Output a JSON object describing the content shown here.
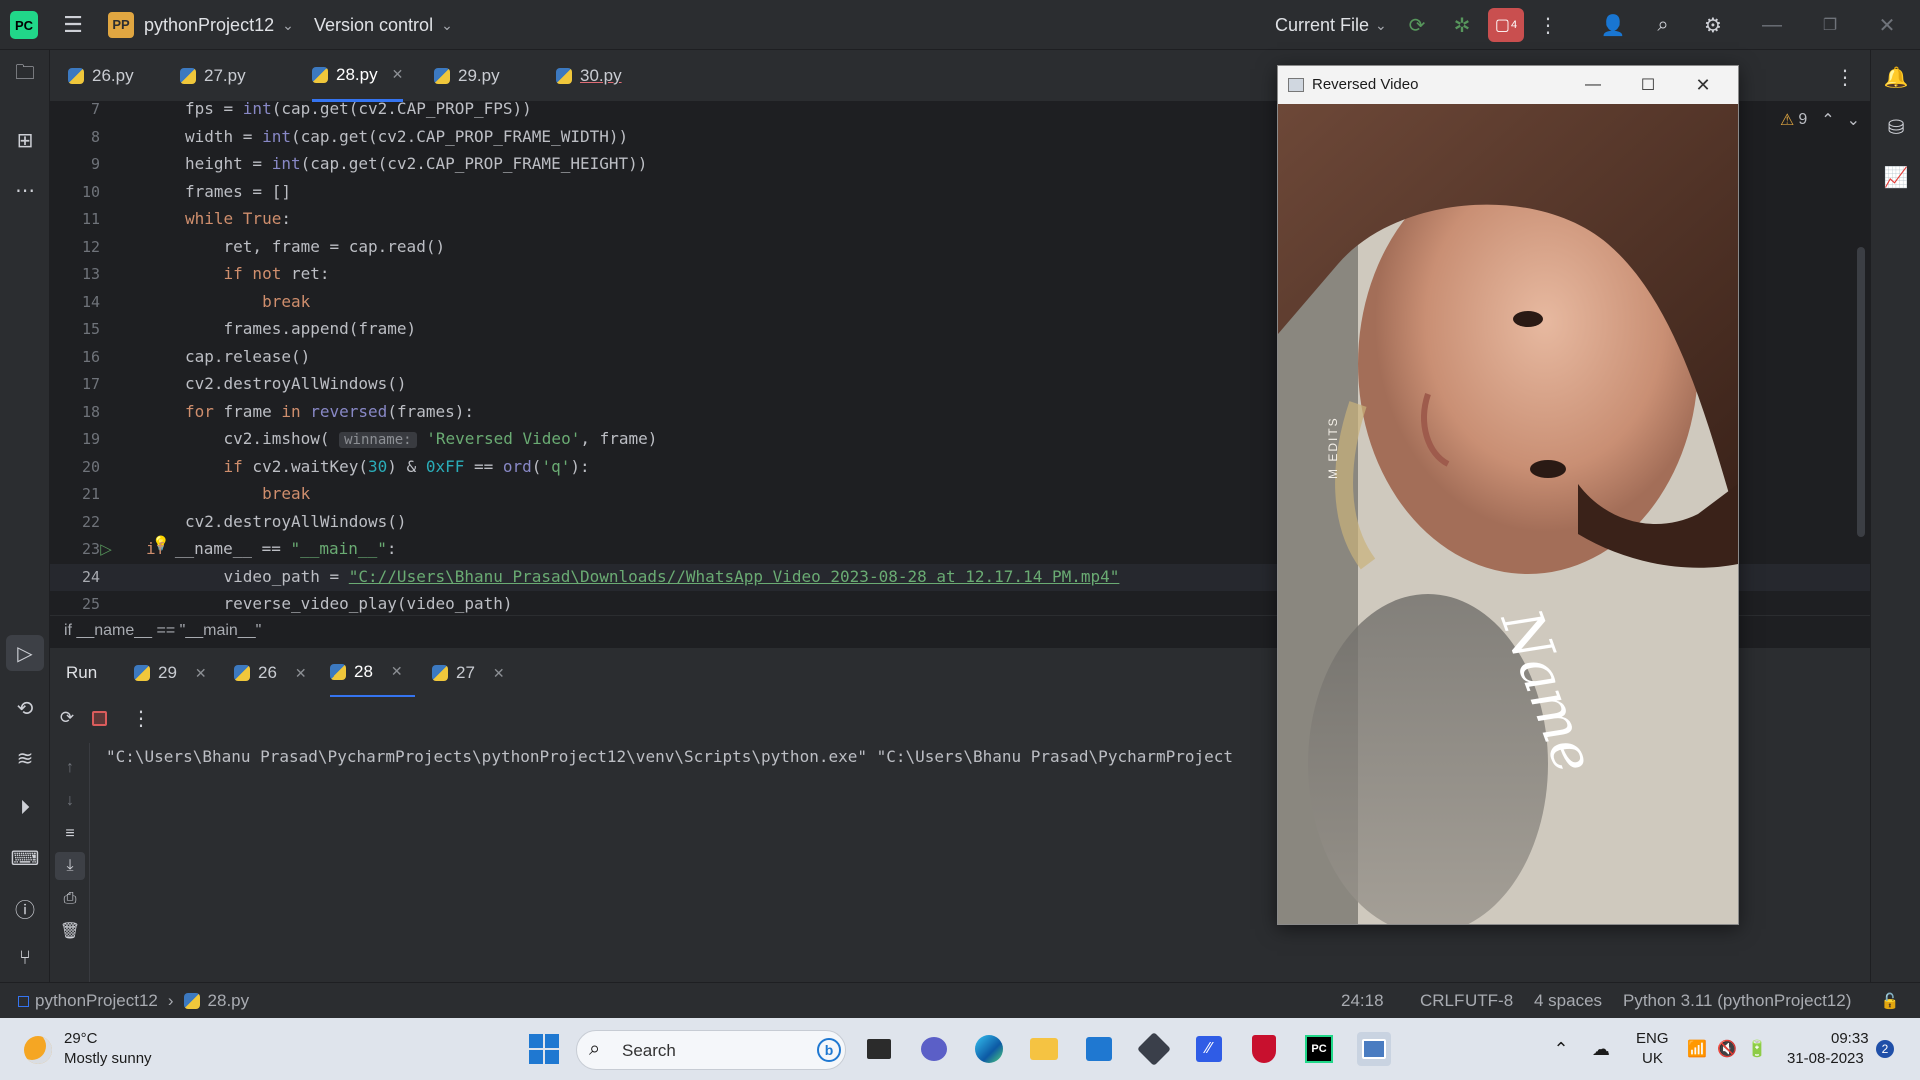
{
  "titlebar": {
    "project_badge": "PP",
    "project_name": "pythonProject12",
    "vcs_label": "Version control",
    "run_config": "Current File",
    "notifications_count": "4"
  },
  "tabs": [
    {
      "label": "26.py"
    },
    {
      "label": "27.py"
    },
    {
      "label": "28.py",
      "active": true
    },
    {
      "label": "29.py"
    },
    {
      "label": "30.py"
    }
  ],
  "editor": {
    "warnings_count": "9",
    "lines": [
      {
        "n": "7",
        "code": "fps = int(cap.get(cv2.CAP_PROP_FPS))"
      },
      {
        "n": "8",
        "code": "width = int(cap.get(cv2.CAP_PROP_FRAME_WIDTH))"
      },
      {
        "n": "9",
        "code": "height = int(cap.get(cv2.CAP_PROP_FRAME_HEIGHT))"
      },
      {
        "n": "10",
        "code": "frames = []"
      },
      {
        "n": "11",
        "code": "while True:"
      },
      {
        "n": "12",
        "code": "    ret, frame = cap.read()"
      },
      {
        "n": "13",
        "code": "    if not ret:"
      },
      {
        "n": "14",
        "code": "        break"
      },
      {
        "n": "15",
        "code": "    frames.append(frame)"
      },
      {
        "n": "16",
        "code": "cap.release()"
      },
      {
        "n": "17",
        "code": "cv2.destroyAllWindows()"
      },
      {
        "n": "18",
        "code": "for frame in reversed(frames):"
      },
      {
        "n": "19",
        "code": "    cv2.imshow( winname: 'Reversed Video', frame)"
      },
      {
        "n": "20",
        "code": "    if cv2.waitKey(30) & 0xFF == ord('q'):"
      },
      {
        "n": "21",
        "code": "        break"
      },
      {
        "n": "22",
        "code": "cv2.destroyAllWindows()"
      },
      {
        "n": "23",
        "code": "if __name__ == \"__main__\":"
      },
      {
        "n": "24",
        "code": "    video_path = \"C://Users\\Bhanu Prasad\\Downloads//WhatsApp Video 2023-08-28 at 12.17.14 PM.mp4\""
      },
      {
        "n": "25",
        "code": "    reverse_video_play(video_path)"
      }
    ],
    "breadcrumb": "if __name__ == \"__main__\""
  },
  "run_panel": {
    "title": "Run",
    "tabs": [
      {
        "label": "29"
      },
      {
        "label": "26"
      },
      {
        "label": "28",
        "active": true
      },
      {
        "label": "27"
      }
    ],
    "console_output": "\"C:\\Users\\Bhanu Prasad\\PycharmProjects\\pythonProject12\\venv\\Scripts\\python.exe\" \"C:\\Users\\Bhanu Prasad\\PycharmProject"
  },
  "video_window": {
    "title": "Reversed Video",
    "overlay_text": "Name",
    "watermark": "M EDITS"
  },
  "statusbar": {
    "project": "pythonProject12",
    "file": "28.py",
    "position": "24:18",
    "line_sep": "CRLF",
    "encoding": "UTF-8",
    "indent": "4 spaces",
    "interpreter": "Python 3.11 (pythonProject12)"
  },
  "taskbar": {
    "weather_temp": "29°C",
    "weather_desc": "Mostly sunny",
    "search_placeholder": "Search",
    "lang_top": "ENG",
    "lang_bottom": "UK",
    "time": "09:33",
    "date": "31-08-2023",
    "notif_count": "2"
  }
}
